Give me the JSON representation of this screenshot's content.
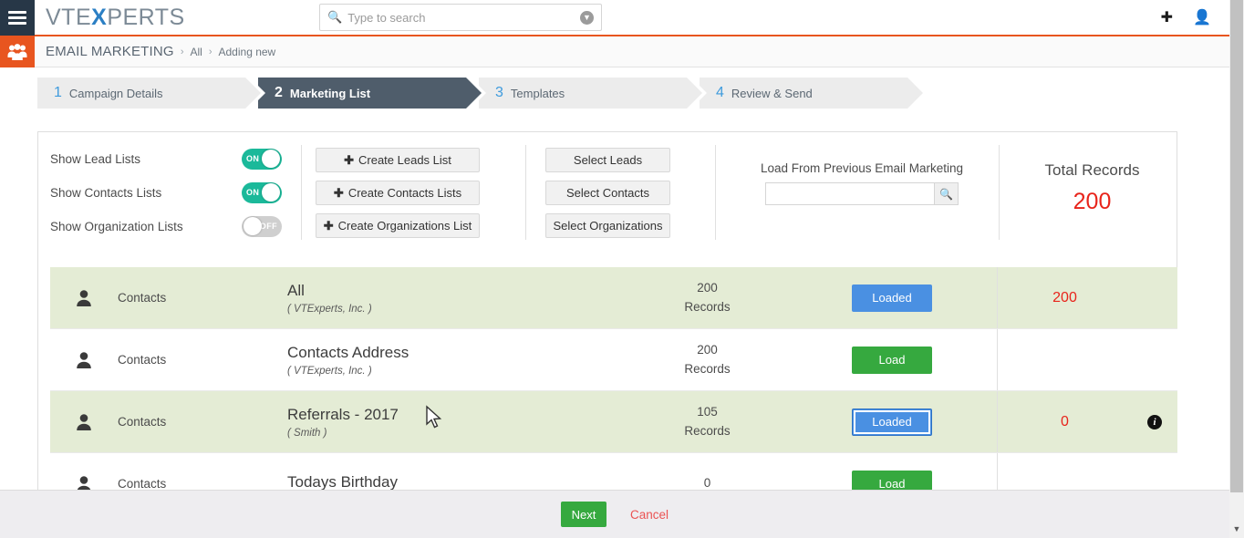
{
  "topbar": {
    "menu_icon": "hamburger-icon",
    "brand_prefix": "VTE",
    "brand_x": "X",
    "brand_suffix": "PERTS",
    "search_placeholder": "Type to search",
    "search_value": "",
    "search_icon": "search-icon",
    "search_dropdown_icon": "chevron-down-circle-icon",
    "add_icon": "plus-circle-icon",
    "user_icon": "user-icon"
  },
  "breadcrumb": {
    "module_icon": "contacts-group-icon",
    "module": "EMAIL MARKETING",
    "sep": "›",
    "list": "All",
    "current": "Adding new"
  },
  "wizard": {
    "steps": [
      {
        "num": "1",
        "label": "Campaign Details",
        "active": false
      },
      {
        "num": "2",
        "label": "Marketing List",
        "active": true
      },
      {
        "num": "3",
        "label": "Templates",
        "active": false
      },
      {
        "num": "4",
        "label": "Review & Send",
        "active": false
      }
    ]
  },
  "controls": {
    "toggles": [
      {
        "label": "Show Lead Lists",
        "state": "ON"
      },
      {
        "label": "Show Contacts Lists",
        "state": "ON"
      },
      {
        "label": "Show Organization Lists",
        "state": "OFF"
      }
    ],
    "create_buttons": [
      {
        "label": "Create Leads List",
        "icon": "plus-icon"
      },
      {
        "label": "Create Contacts Lists",
        "icon": "plus-icon"
      },
      {
        "label": "Create Organizations List",
        "icon": "plus-icon"
      }
    ],
    "select_buttons": [
      {
        "label": "Select Leads"
      },
      {
        "label": "Select Contacts"
      },
      {
        "label": "Select Organizations"
      }
    ],
    "load_previous": {
      "title": "Load From Previous Email Marketing",
      "input_value": "",
      "input_placeholder": "",
      "search_icon": "search-icon"
    },
    "total_records": {
      "title": "Total Records",
      "value": "200",
      "color": "#e8241b"
    }
  },
  "list": {
    "rows": [
      {
        "type_icon": "person-icon",
        "type": "Contacts",
        "name": "All",
        "owner": "( VTExperts, Inc. )",
        "count": "200",
        "count_unit": "Records",
        "button_label": "Loaded",
        "button_state": "loaded",
        "result": "200",
        "selected": true,
        "focused": false,
        "info_icon": ""
      },
      {
        "type_icon": "person-icon",
        "type": "Contacts",
        "name": "Contacts Address",
        "owner": "( VTExperts, Inc. )",
        "count": "200",
        "count_unit": "Records",
        "button_label": "Load",
        "button_state": "load",
        "result": "",
        "selected": false,
        "focused": false,
        "info_icon": ""
      },
      {
        "type_icon": "person-icon",
        "type": "Contacts",
        "name": "Referrals - 2017",
        "owner": "( Smith )",
        "count": "105",
        "count_unit": "Records",
        "button_label": "Loaded",
        "button_state": "loaded",
        "result": "0",
        "selected": true,
        "focused": true,
        "info_icon": "info-icon"
      },
      {
        "type_icon": "person-icon",
        "type": "Contacts",
        "name": "Todays Birthday",
        "owner": "",
        "count": "0",
        "count_unit": "",
        "button_label": "Load",
        "button_state": "load",
        "result": "",
        "selected": false,
        "focused": false,
        "info_icon": ""
      }
    ]
  },
  "footer": {
    "next_label": "Next",
    "cancel_label": "Cancel"
  },
  "scrollbar": {
    "down_arrow_icon": "chevron-down-icon"
  },
  "colors": {
    "accent_orange": "#e8551f",
    "toggle_on": "#1bb99a",
    "button_green": "#36a93f",
    "button_blue": "#4a90e2",
    "red_number": "#e8241b",
    "row_selected": "#e4ecd5",
    "wizard_active": "#4f5d6b",
    "step_number_blue": "#3e9bdd"
  }
}
